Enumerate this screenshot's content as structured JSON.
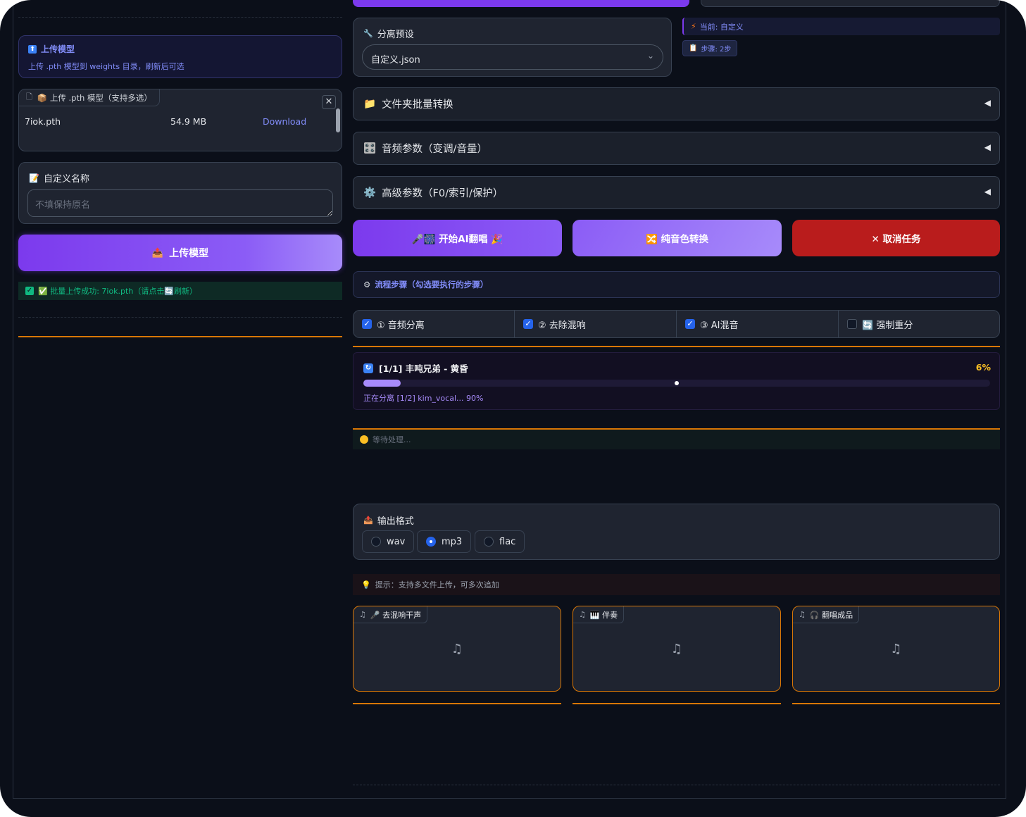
{
  "left": {
    "upload_info": {
      "icon": "upload-arrow-icon",
      "title": "上传模型",
      "desc": "上传 .pth 模型到 weights 目录，刷新后可选"
    },
    "file_box": {
      "tab_label": "📦 上传 .pth 模型（支持多选）",
      "close": "✕",
      "file_name": "7iok.pth",
      "file_size": "54.9 MB",
      "download": "Download"
    },
    "name_box": {
      "label": "自定义名称",
      "placeholder": "不填保持原名"
    },
    "upload_button": "上传模型",
    "success_text": "✅ 批量上传成功: 7iok.pth（请点击🔄刷新）"
  },
  "right": {
    "preset": {
      "label": "分离预设",
      "value": "自定义.json"
    },
    "current_badge": "当前: 自定义",
    "steps_badge": "步骤: 2步",
    "accordions": [
      {
        "icon": "📁",
        "label": "文件夹批量转换"
      },
      {
        "icon": "🎛️",
        "label": "音频参数（变调/音量）"
      },
      {
        "icon": "⚙️",
        "label": "高级参数（F0/索引/保护）"
      }
    ],
    "buttons": {
      "start": "🎤🎆 开始AI翻唱 🎉",
      "pure": "🔀 纯音色转换",
      "cancel": "✕ 取消任务"
    },
    "flow_label": "流程步骤（勾选要执行的步骤）",
    "steps": [
      {
        "label": "① 音频分离",
        "checked": true
      },
      {
        "label": "② 去除混响",
        "checked": true
      },
      {
        "label": "③ AI混音",
        "checked": true
      },
      {
        "label": "🔄 强制重分",
        "checked": false
      }
    ],
    "progress": {
      "title": "[1/1] 丰吨兄弟 - 黄昏",
      "percent_text": "6%",
      "percent": 0.06,
      "status": "正在分离 [1/2] kim_vocal... 90%"
    },
    "waiting": "等待处理...",
    "format": {
      "label": "输出格式",
      "options": [
        "wav",
        "mp3",
        "flac"
      ],
      "selected": "mp3"
    },
    "tip": "提示：支持多文件上传，可多次追加",
    "audio_outputs": [
      {
        "label": "🎤 去混响干声"
      },
      {
        "label": "🎹 伴奏"
      },
      {
        "label": "🎧 翻唱成品"
      }
    ]
  },
  "colors": {
    "accent": "#7c3aed",
    "cancel": "#b91c1c",
    "warning_orange": "#d97706",
    "success": "#10b981"
  }
}
